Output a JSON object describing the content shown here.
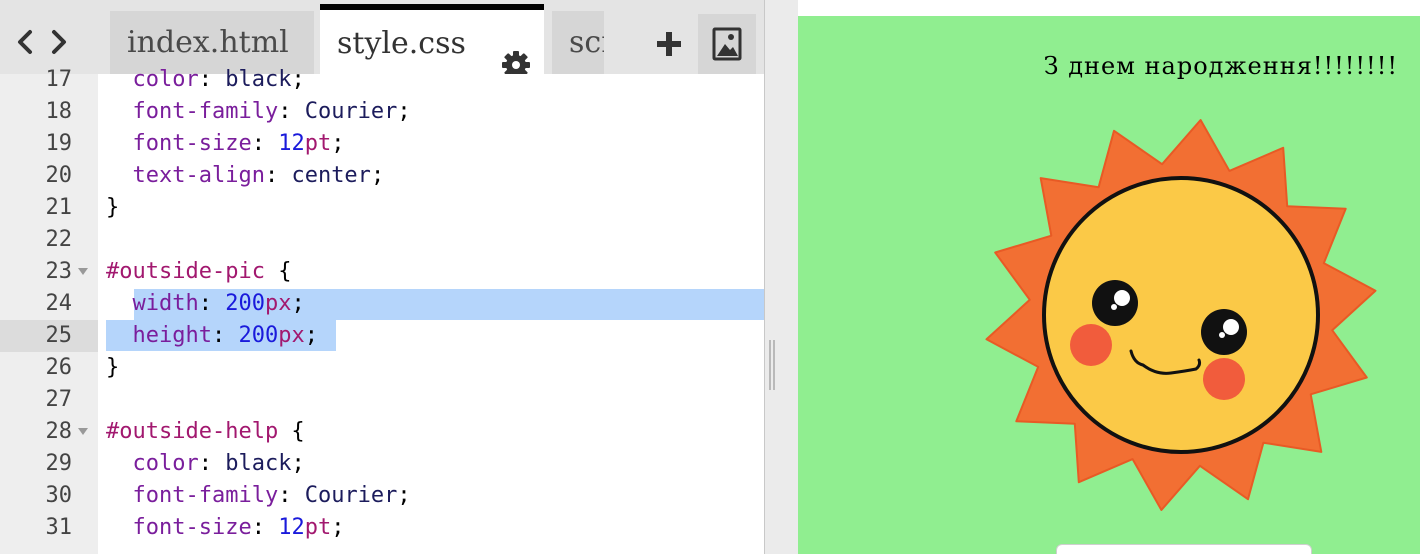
{
  "editor": {
    "tabs": [
      {
        "label": "index.html",
        "active": false
      },
      {
        "label": "style.css",
        "active": true
      },
      {
        "label": "scr",
        "active": false
      }
    ],
    "icons": {
      "back": "chevron-left-icon",
      "forward": "chevron-right-icon",
      "settings": "gear-icon",
      "add": "plus-icon",
      "image": "image-icon"
    },
    "lines": [
      {
        "num": "17",
        "text": "  color: black;"
      },
      {
        "num": "18",
        "text": "  font-family: Courier;"
      },
      {
        "num": "19",
        "text": "  font-size: 12pt;"
      },
      {
        "num": "20",
        "text": "  text-align: center;"
      },
      {
        "num": "21",
        "text": "}"
      },
      {
        "num": "22",
        "text": ""
      },
      {
        "num": "23",
        "text": "#outside-pic {"
      },
      {
        "num": "24",
        "text": "  width: 200px;"
      },
      {
        "num": "25",
        "text": "  height: 200px;"
      },
      {
        "num": "26",
        "text": "}"
      },
      {
        "num": "27",
        "text": ""
      },
      {
        "num": "28",
        "text": "#outside-help {"
      },
      {
        "num": "29",
        "text": "  color: black;"
      },
      {
        "num": "30",
        "text": "  font-family: Courier;"
      },
      {
        "num": "31",
        "text": "  font-size: 12pt;"
      }
    ],
    "active_line": "25",
    "selected_lines": [
      "24",
      "25"
    ],
    "fold_lines": [
      "23",
      "28"
    ]
  },
  "preview": {
    "heading": "З днем народження!!!!!!!!",
    "background": "#90ee90",
    "image": "smiling-sun-image"
  },
  "colors": {
    "selection": "#b5d5fb",
    "property": "#7a1e9c",
    "selector": "#a2186f",
    "number": "#1a1adb",
    "active_tab_border": "#000000"
  }
}
